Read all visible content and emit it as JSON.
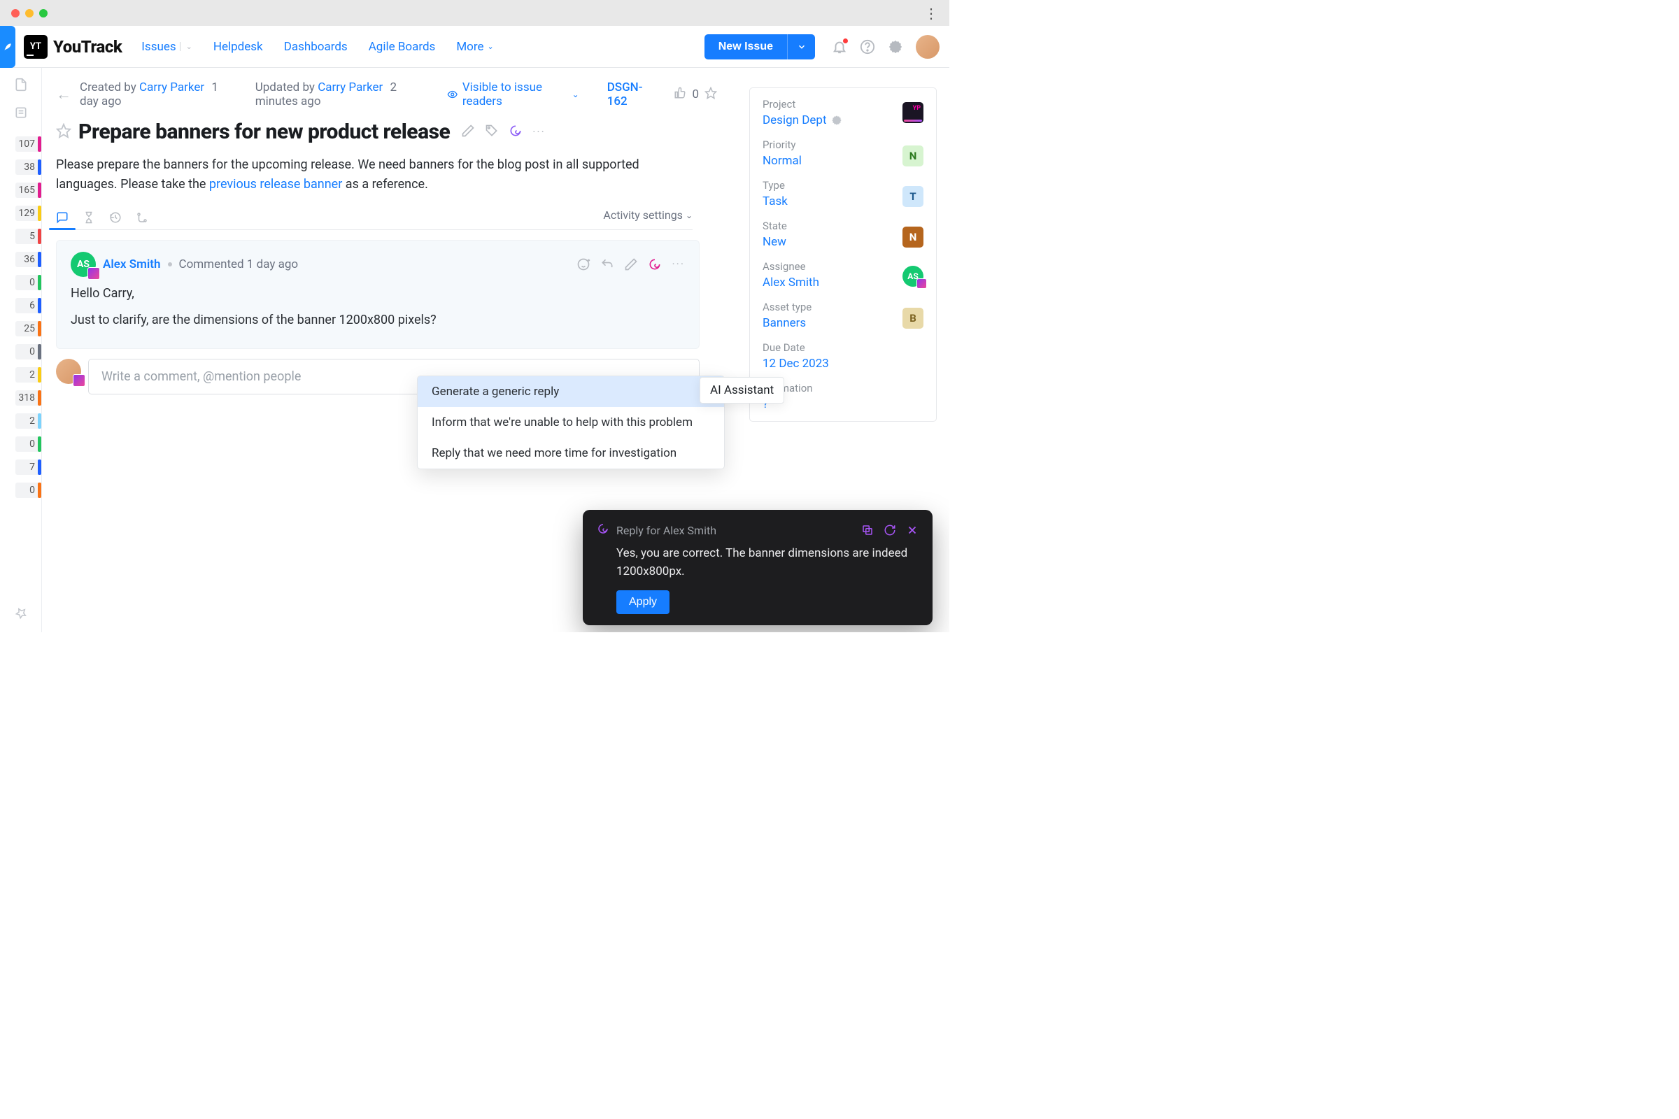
{
  "nav": {
    "logo_text": "YouTrack",
    "logo_mark": "YT",
    "links": [
      "Issues",
      "Helpdesk",
      "Dashboards",
      "Agile Boards",
      "More"
    ],
    "new_issue": "New Issue"
  },
  "rail_counts": [
    {
      "n": "107",
      "color": "#e11d8f"
    },
    {
      "n": "38",
      "color": "#1f5fff"
    },
    {
      "n": "165",
      "color": "#e11d8f"
    },
    {
      "n": "129",
      "color": "#facc15"
    },
    {
      "n": "5",
      "color": "#ef4444"
    },
    {
      "n": "36",
      "color": "#1f5fff"
    },
    {
      "n": "0",
      "color": "#22c55e"
    },
    {
      "n": "6",
      "color": "#1f5fff"
    },
    {
      "n": "25",
      "color": "#f97316"
    },
    {
      "n": "0",
      "color": "#6b7280"
    },
    {
      "n": "2",
      "color": "#facc15"
    },
    {
      "n": "318",
      "color": "#f97316"
    },
    {
      "n": "2",
      "color": "#7dd3fc"
    },
    {
      "n": "0",
      "color": "#22c55e"
    },
    {
      "n": "7",
      "color": "#1f5fff"
    },
    {
      "n": "0",
      "color": "#f97316"
    }
  ],
  "header": {
    "created_by_prefix": "Created by ",
    "created_by": "Carry Parker",
    "created_ago": "1 day ago",
    "updated_by_prefix": "Updated by ",
    "updated_by": "Carry Parker",
    "updated_ago": "2 minutes ago",
    "visibility": "Visible to issue readers",
    "issue_key": "DSGN-162",
    "votes": "0"
  },
  "issue": {
    "title": "Prepare banners for new product release",
    "description_pre": "Please prepare the banners for the upcoming release. We need banners for the blog post in all supported languages. Please take the ",
    "description_link": "previous release banner",
    "description_post": " as a reference."
  },
  "activity_settings_label": "Activity settings",
  "comment": {
    "author_initials": "AS",
    "author": "Alex Smith",
    "meta": "Commented 1 day ago",
    "line1": "Hello Carry,",
    "line2": "Just to clarify, are the dimensions of the banner 1200x800 pixels?"
  },
  "comment_placeholder": "Write a comment, @mention people",
  "ai_menu": {
    "label": "AI Assistant",
    "items": [
      "Generate a generic reply",
      "Inform that we're unable to help with this problem",
      "Reply that we need more time for investigation"
    ]
  },
  "sidebar": {
    "fields": {
      "project": {
        "label": "Project",
        "value": "Design Dept"
      },
      "priority": {
        "label": "Priority",
        "value": "Normal",
        "badge": "N"
      },
      "type": {
        "label": "Type",
        "value": "Task",
        "badge": "T"
      },
      "state": {
        "label": "State",
        "value": "New",
        "badge": "N"
      },
      "assignee": {
        "label": "Assignee",
        "value": "Alex Smith",
        "initials": "AS"
      },
      "asset_type": {
        "label": "Asset type",
        "value": "Banners",
        "badge": "B"
      },
      "due_date": {
        "label": "Due Date",
        "value": "12 Dec 2023"
      },
      "estimation": {
        "label": "Estimation",
        "value": "?"
      }
    }
  },
  "ai_toast": {
    "title": "Reply for Alex Smith",
    "body": "Yes, you are correct. The banner dimensions are indeed 1200x800px.",
    "apply": "Apply"
  }
}
